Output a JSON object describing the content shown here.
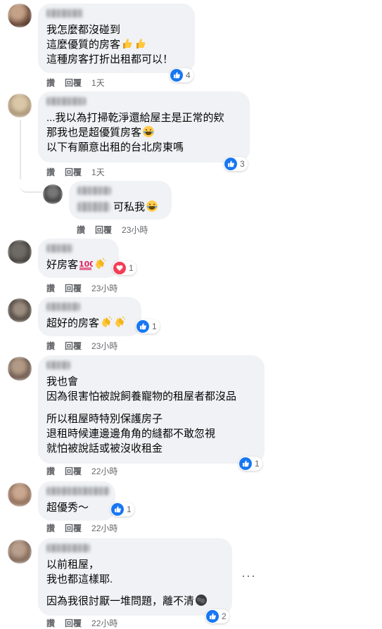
{
  "actions": {
    "like": "讚",
    "reply": "回覆"
  },
  "comments": [
    {
      "lines": [
        "我怎麼都沒碰到",
        "這麼優質的房客",
        "這種房客打折出租都可以！"
      ],
      "reaction_count": "4",
      "time": "1天"
    },
    {
      "lines": [
        "...我以為打掃乾淨還給屋主是正常的欸",
        "那我也是超優質房客",
        "以下有願意出租的台北房東嗎"
      ],
      "reaction_count": "3",
      "time": "1天"
    },
    {
      "lines": [
        "可私我"
      ],
      "time": "23小時"
    },
    {
      "lines": [
        "好房客"
      ],
      "reaction_count": "1",
      "time": "23小時"
    },
    {
      "lines": [
        "超好的房客"
      ],
      "reaction_count": "1",
      "time": "23小時"
    },
    {
      "lines": [
        "我也會",
        "因為很害怕被說飼養寵物的租屋者都沒品",
        "所以租屋時特別保護房子",
        "退租時候連邊邊角角的縫都不敢忽視",
        "就怕被說話或被沒收租金"
      ],
      "reaction_count": "1",
      "time": "22小時"
    },
    {
      "lines": [
        "超優秀～"
      ],
      "reaction_count": "1",
      "time": "22小時"
    },
    {
      "lines": [
        "以前租屋，",
        "我也都這樣耶.",
        "因為我很討厭一堆問題，離不清"
      ],
      "reaction_count": "2",
      "time": "22小時"
    }
  ],
  "colors": {
    "bubble": "#f0f2f5",
    "like": "#1877f2",
    "love": "#f33e58",
    "meta": "#65676b"
  }
}
